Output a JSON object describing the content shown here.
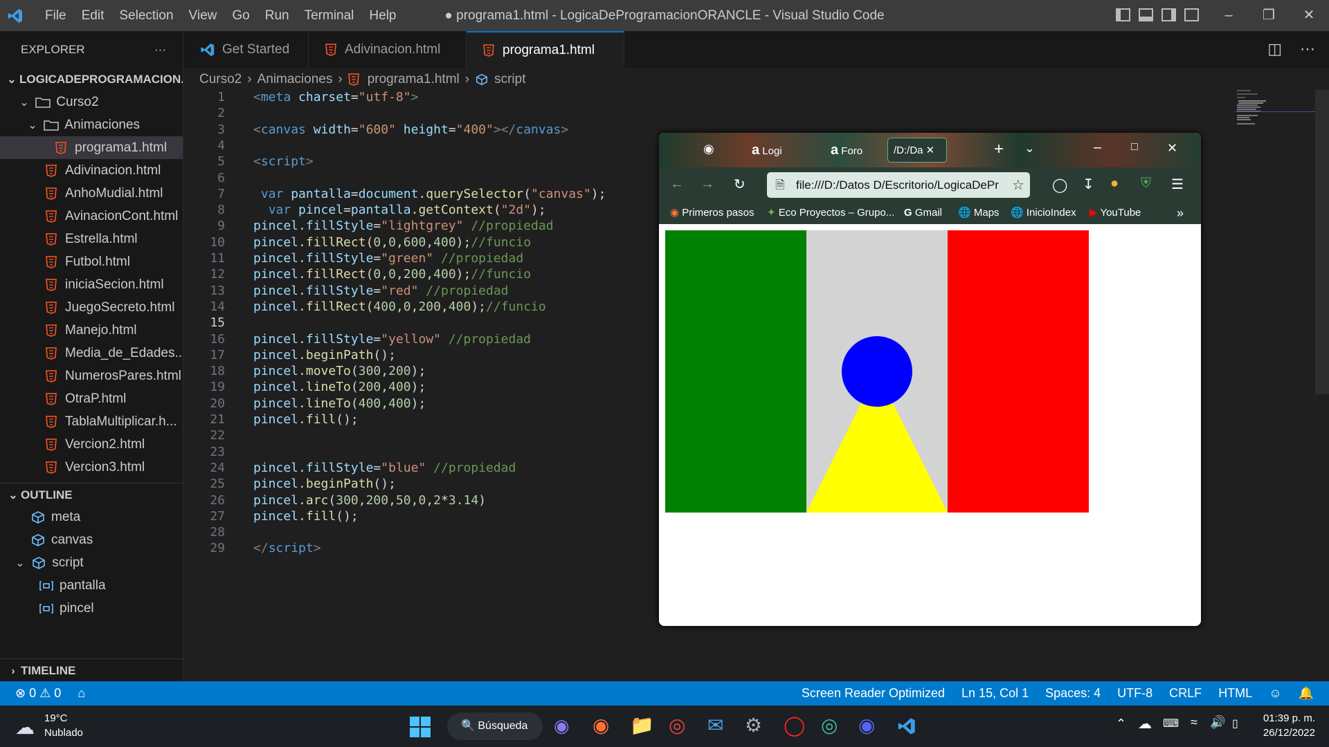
{
  "titlebar": {
    "menu": [
      "File",
      "Edit",
      "Selection",
      "View",
      "Go",
      "Run",
      "Terminal",
      "Help"
    ],
    "title": "● programa1.html - LogicaDeProgramacionORANCLE - Visual Studio Code"
  },
  "sidebar": {
    "header": "EXPLORER",
    "more": "···",
    "root": "LOGICADEPROGRAMACION...",
    "folder1": "Curso2",
    "folder2": "Animaciones",
    "active_file": "programa1.html",
    "files": [
      "Adivinacion.html",
      "AnhoMudial.html",
      "AvinacionCont.html",
      "Estrella.html",
      "Futbol.html",
      "iniciaSecion.html",
      "JuegoSecreto.html",
      "Manejo.html",
      "Media_de_Edades...",
      "NumerosPares.html",
      "OtraP.html",
      "TablaMultiplicar.h...",
      "Vercion2.html",
      "Vercion3.html"
    ],
    "outline_title": "OUTLINE",
    "outline": [
      "meta",
      "canvas",
      "script",
      "pantalla",
      "pincel"
    ],
    "timeline_title": "TIMELINE"
  },
  "tabs": [
    {
      "label": "Get Started"
    },
    {
      "label": "Adivinacion.html"
    },
    {
      "label": "programa1.html"
    }
  ],
  "breadcrumb": [
    "Curso2",
    "Animaciones",
    "programa1.html",
    "script"
  ],
  "code": {
    "line_numbers": [
      "1",
      "2",
      "3",
      "4",
      "5",
      "6",
      "7",
      "8",
      "9",
      "10",
      "11",
      "12",
      "13",
      "14",
      "15",
      "16",
      "17",
      "18",
      "19",
      "20",
      "21",
      "22",
      "23",
      "24",
      "25",
      "26",
      "27",
      "28",
      "29"
    ],
    "lines": [
      [
        [
          "t-tag",
          "<"
        ],
        [
          "t-name",
          "meta"
        ],
        [
          "t-punc",
          " "
        ],
        [
          "t-attr",
          "charset"
        ],
        [
          "t-punc",
          "="
        ],
        [
          "t-str",
          "\"utf-8\""
        ],
        [
          "t-tag",
          ">"
        ]
      ],
      [],
      [
        [
          "t-tag",
          "<"
        ],
        [
          "t-name",
          "canvas"
        ],
        [
          "t-punc",
          " "
        ],
        [
          "t-attr",
          "width"
        ],
        [
          "t-punc",
          "="
        ],
        [
          "t-str",
          "\"600\""
        ],
        [
          "t-punc",
          " "
        ],
        [
          "t-attr",
          "height"
        ],
        [
          "t-punc",
          "="
        ],
        [
          "t-str",
          "\"400\""
        ],
        [
          "t-tag",
          "></"
        ],
        [
          "t-name",
          "canvas"
        ],
        [
          "t-tag",
          ">"
        ]
      ],
      [],
      [
        [
          "t-tag",
          "<"
        ],
        [
          "t-name",
          "script"
        ],
        [
          "t-tag",
          ">"
        ]
      ],
      [],
      [
        [
          "t-punc",
          " "
        ],
        [
          "t-var",
          "var"
        ],
        [
          "t-punc",
          " "
        ],
        [
          "t-id",
          "pantalla"
        ],
        [
          "t-punc",
          "="
        ],
        [
          "t-id",
          "document"
        ],
        [
          "t-punc",
          "."
        ],
        [
          "t-fn",
          "querySelector"
        ],
        [
          "t-punc",
          "("
        ],
        [
          "t-str",
          "\"canvas\""
        ],
        [
          "t-punc",
          ");"
        ]
      ],
      [
        [
          "t-punc",
          "  "
        ],
        [
          "t-var",
          "var"
        ],
        [
          "t-punc",
          " "
        ],
        [
          "t-id",
          "pincel"
        ],
        [
          "t-punc",
          "="
        ],
        [
          "t-id",
          "pantalla"
        ],
        [
          "t-punc",
          "."
        ],
        [
          "t-fn",
          "getContext"
        ],
        [
          "t-punc",
          "("
        ],
        [
          "t-str",
          "\"2d\""
        ],
        [
          "t-punc",
          ");"
        ]
      ],
      [
        [
          "t-id",
          "pincel"
        ],
        [
          "t-punc",
          "."
        ],
        [
          "t-id",
          "fillStyle"
        ],
        [
          "t-punc",
          "="
        ],
        [
          "t-str",
          "\"lightgrey\""
        ],
        [
          "t-punc",
          " "
        ],
        [
          "t-com",
          "//propiedad"
        ]
      ],
      [
        [
          "t-id",
          "pincel"
        ],
        [
          "t-punc",
          "."
        ],
        [
          "t-fn",
          "fillRect"
        ],
        [
          "t-punc",
          "("
        ],
        [
          "t-num",
          "0"
        ],
        [
          "t-punc",
          ","
        ],
        [
          "t-num",
          "0"
        ],
        [
          "t-punc",
          ","
        ],
        [
          "t-num",
          "600"
        ],
        [
          "t-punc",
          ","
        ],
        [
          "t-num",
          "400"
        ],
        [
          "t-punc",
          ");"
        ],
        [
          "t-com",
          "//funcio"
        ]
      ],
      [
        [
          "t-id",
          "pincel"
        ],
        [
          "t-punc",
          "."
        ],
        [
          "t-id",
          "fillStyle"
        ],
        [
          "t-punc",
          "="
        ],
        [
          "t-str",
          "\"green\""
        ],
        [
          "t-punc",
          " "
        ],
        [
          "t-com",
          "//propiedad"
        ]
      ],
      [
        [
          "t-id",
          "pincel"
        ],
        [
          "t-punc",
          "."
        ],
        [
          "t-fn",
          "fillRect"
        ],
        [
          "t-punc",
          "("
        ],
        [
          "t-num",
          "0"
        ],
        [
          "t-punc",
          ","
        ],
        [
          "t-num",
          "0"
        ],
        [
          "t-punc",
          ","
        ],
        [
          "t-num",
          "200"
        ],
        [
          "t-punc",
          ","
        ],
        [
          "t-num",
          "400"
        ],
        [
          "t-punc",
          ");"
        ],
        [
          "t-com",
          "//funcio"
        ]
      ],
      [
        [
          "t-id",
          "pincel"
        ],
        [
          "t-punc",
          "."
        ],
        [
          "t-id",
          "fillStyle"
        ],
        [
          "t-punc",
          "="
        ],
        [
          "t-str",
          "\"red\""
        ],
        [
          "t-punc",
          " "
        ],
        [
          "t-com",
          "//propiedad"
        ]
      ],
      [
        [
          "t-id",
          "pincel"
        ],
        [
          "t-punc",
          "."
        ],
        [
          "t-fn",
          "fillRect"
        ],
        [
          "t-punc",
          "("
        ],
        [
          "t-num",
          "400"
        ],
        [
          "t-punc",
          ","
        ],
        [
          "t-num",
          "0"
        ],
        [
          "t-punc",
          ","
        ],
        [
          "t-num",
          "200"
        ],
        [
          "t-punc",
          ","
        ],
        [
          "t-num",
          "400"
        ],
        [
          "t-punc",
          ");"
        ],
        [
          "t-com",
          "//funcio"
        ]
      ],
      [],
      [
        [
          "t-id",
          "pincel"
        ],
        [
          "t-punc",
          "."
        ],
        [
          "t-id",
          "fillStyle"
        ],
        [
          "t-punc",
          "="
        ],
        [
          "t-str",
          "\"yellow\""
        ],
        [
          "t-punc",
          " "
        ],
        [
          "t-com",
          "//propiedad"
        ]
      ],
      [
        [
          "t-id",
          "pincel"
        ],
        [
          "t-punc",
          "."
        ],
        [
          "t-fn",
          "beginPath"
        ],
        [
          "t-punc",
          "();"
        ]
      ],
      [
        [
          "t-id",
          "pincel"
        ],
        [
          "t-punc",
          "."
        ],
        [
          "t-fn",
          "moveTo"
        ],
        [
          "t-punc",
          "("
        ],
        [
          "t-num",
          "300"
        ],
        [
          "t-punc",
          ","
        ],
        [
          "t-num",
          "200"
        ],
        [
          "t-punc",
          ");"
        ]
      ],
      [
        [
          "t-id",
          "pincel"
        ],
        [
          "t-punc",
          "."
        ],
        [
          "t-fn",
          "lineTo"
        ],
        [
          "t-punc",
          "("
        ],
        [
          "t-num",
          "200"
        ],
        [
          "t-punc",
          ","
        ],
        [
          "t-num",
          "400"
        ],
        [
          "t-punc",
          ");"
        ]
      ],
      [
        [
          "t-id",
          "pincel"
        ],
        [
          "t-punc",
          "."
        ],
        [
          "t-fn",
          "lineTo"
        ],
        [
          "t-punc",
          "("
        ],
        [
          "t-num",
          "400"
        ],
        [
          "t-punc",
          ","
        ],
        [
          "t-num",
          "400"
        ],
        [
          "t-punc",
          ");"
        ]
      ],
      [
        [
          "t-id",
          "pincel"
        ],
        [
          "t-punc",
          "."
        ],
        [
          "t-fn",
          "fill"
        ],
        [
          "t-punc",
          "();"
        ]
      ],
      [],
      [],
      [
        [
          "t-id",
          "pincel"
        ],
        [
          "t-punc",
          "."
        ],
        [
          "t-id",
          "fillStyle"
        ],
        [
          "t-punc",
          "="
        ],
        [
          "t-str",
          "\"blue\""
        ],
        [
          "t-punc",
          " "
        ],
        [
          "t-com",
          "//propiedad"
        ]
      ],
      [
        [
          "t-id",
          "pincel"
        ],
        [
          "t-punc",
          "."
        ],
        [
          "t-fn",
          "beginPath"
        ],
        [
          "t-punc",
          "();"
        ]
      ],
      [
        [
          "t-id",
          "pincel"
        ],
        [
          "t-punc",
          "."
        ],
        [
          "t-fn",
          "arc"
        ],
        [
          "t-punc",
          "("
        ],
        [
          "t-num",
          "300"
        ],
        [
          "t-punc",
          ","
        ],
        [
          "t-num",
          "200"
        ],
        [
          "t-punc",
          ","
        ],
        [
          "t-num",
          "50"
        ],
        [
          "t-punc",
          ","
        ],
        [
          "t-num",
          "0"
        ],
        [
          "t-punc",
          ","
        ],
        [
          "t-num",
          "2"
        ],
        [
          "t-punc",
          "*"
        ],
        [
          "t-num",
          "3.14"
        ],
        [
          "t-punc",
          ")"
        ]
      ],
      [
        [
          "t-id",
          "pincel"
        ],
        [
          "t-punc",
          "."
        ],
        [
          "t-fn",
          "fill"
        ],
        [
          "t-punc",
          "();"
        ]
      ],
      [],
      [
        [
          "t-tag",
          "</"
        ],
        [
          "t-name",
          "script"
        ],
        [
          "t-tag",
          ">"
        ]
      ]
    ]
  },
  "browser": {
    "tabs": [
      "Logi",
      "Foro",
      "/D:/Da"
    ],
    "url": "file:///D:/Datos D/Escritorio/LogicaDePr",
    "bookmarks": [
      "Primeros pasos",
      "Eco Proyectos – Grupo...",
      "Gmail",
      "Maps",
      "InicioIndex",
      "YouTube"
    ],
    "canvas": {
      "width": 600,
      "height": 400,
      "colors": {
        "background": "#d3d3d3",
        "left": "#008000",
        "right": "#ff0000",
        "triangle": "#ffff00",
        "circle": "#0000ff"
      }
    }
  },
  "status": {
    "errors": "0",
    "warnings": "0",
    "screen_reader": "Screen Reader Optimized",
    "position": "Ln 15, Col 1",
    "spaces": "Spaces: 4",
    "encoding": "UTF-8",
    "eol": "CRLF",
    "language": "HTML"
  },
  "taskbar": {
    "temp": "19°C",
    "weather": "Nublado",
    "search": "Búsqueda",
    "time": "01:39 p. m.",
    "date": "26/12/2022"
  }
}
